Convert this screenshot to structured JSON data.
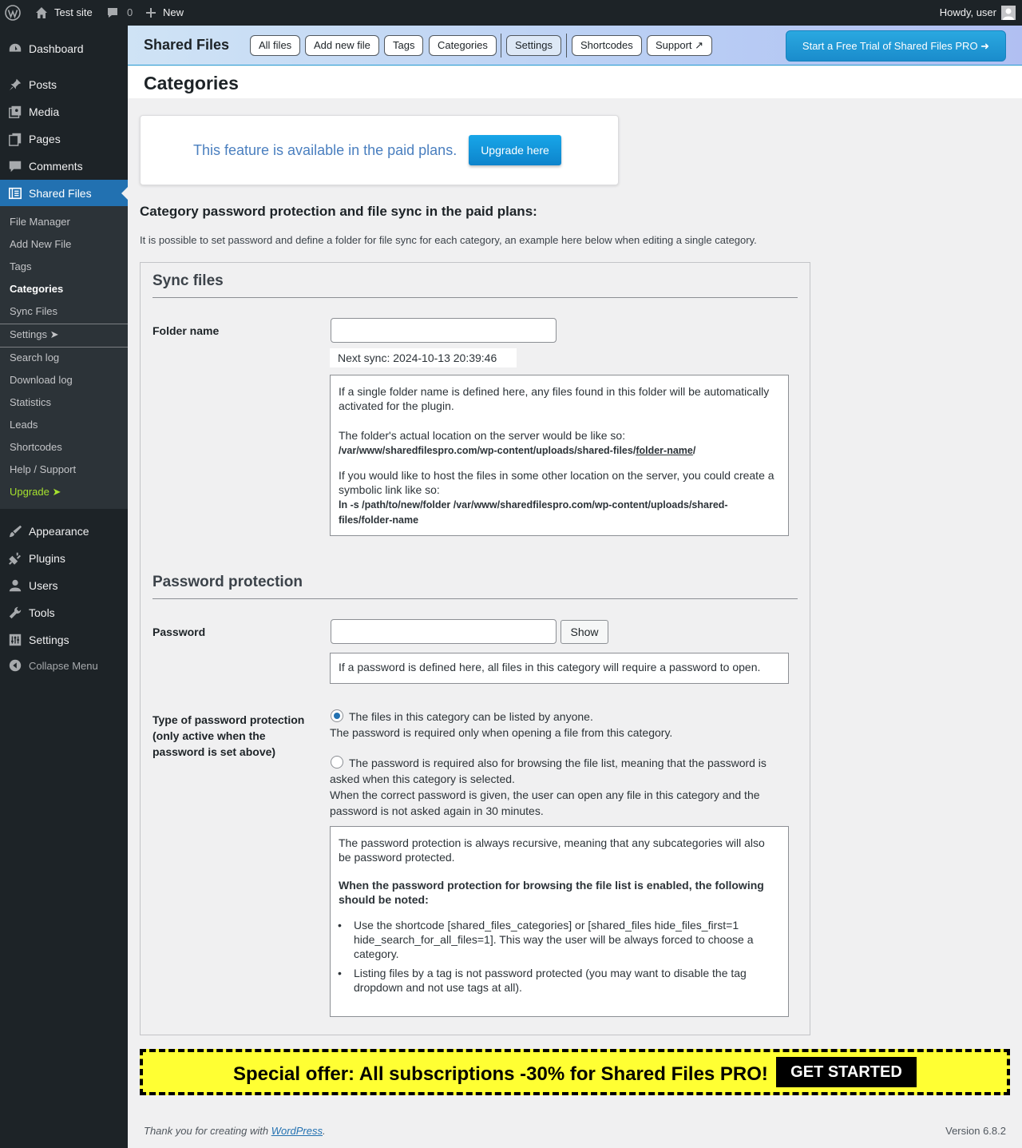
{
  "adminbar": {
    "site_name": "Test site",
    "comments_count": "0",
    "new_label": "New",
    "howdy": "Howdy, user"
  },
  "sidebar": {
    "dashboard": "Dashboard",
    "posts": "Posts",
    "media": "Media",
    "pages": "Pages",
    "comments": "Comments",
    "shared_files": "Shared Files",
    "submenu": [
      "File Manager",
      "Add New File",
      "Tags",
      "Categories",
      "Sync Files",
      "Settings ➤",
      "Search log",
      "Download log",
      "Statistics",
      "Leads",
      "Shortcodes",
      "Help / Support",
      "Upgrade ➤"
    ],
    "appearance": "Appearance",
    "plugins": "Plugins",
    "users": "Users",
    "tools": "Tools",
    "settings": "Settings",
    "collapse": "Collapse Menu"
  },
  "pluginnav": {
    "brand": "Shared Files",
    "buttons": [
      "All files",
      "Add new file",
      "Tags",
      "Categories",
      "Settings",
      "Shortcodes",
      "Support ↗"
    ],
    "trial": "Start a Free Trial of Shared Files PRO ➜"
  },
  "page": {
    "title": "Categories",
    "upgrade_text": "This feature is available in the paid plans.",
    "upgrade_button": "Upgrade here",
    "heading": "Category password protection and file sync in the paid plans:",
    "intro": "It is possible to set password and define a folder for file sync for each category, an example here below when editing a single category."
  },
  "sync": {
    "title": "Sync files",
    "folder_label": "Folder name",
    "folder_value": "",
    "next_sync": "Next sync: 2024-10-13 20:39:46",
    "info_p1": "If a single folder name is defined here, any files found in this folder will be automatically activated for the plugin.",
    "info_p2": "The folder's actual location on the server would be like so:",
    "path_prefix": "/var/www/sharedfilespro.com/wp-content/uploads/shared-files/",
    "path_folder": "folder-name",
    "path_suffix": "/",
    "info_p3": "If you would like to host the files in some other location on the server, you could create a symbolic link like so:",
    "symlink": "ln -s /path/to/new/folder /var/www/sharedfilespro.com/wp-content/uploads/shared-files/folder-name"
  },
  "password": {
    "title": "Password protection",
    "label": "Password",
    "value": "",
    "show_button": "Show",
    "info": "If a password is defined here, all files in this category will require a password to open.",
    "type_label": "Type of password protection (only active when the password is set above)",
    "option1_line1": "The files in this category can be listed by anyone.",
    "option1_line2": "The password is required only when opening a file from this category.",
    "option2_text": "The password is required also for browsing the file list, meaning that the password is asked when this category is selected.",
    "option2_extra": "When the correct password is given, the user can open any file in this category and the password is not asked again in 30 minutes.",
    "note_p1": "The password protection is always recursive, meaning that any subcategories will also be password protected.",
    "note_p2": "When the password protection for browsing the file list is enabled, the following should be noted:",
    "bullets": [
      "Use the shortcode [shared_files_categories] or [shared_files hide_files_first=1 hide_search_for_all_files=1]. This way the user will be always forced to choose a category.",
      "Listing files by a tag is not password protected (you may want to disable the tag dropdown and not use tags at all)."
    ]
  },
  "offer": {
    "text": "Special offer: All subscriptions -30% for Shared Files PRO!",
    "cta": "GET STARTED"
  },
  "footer": {
    "thanks_prefix": "Thank you for creating with ",
    "wordpress": "WordPress",
    "thanks_suffix": ".",
    "version": "Version 6.8.2"
  },
  "colors": {
    "admin_dark": "#1d2327",
    "accent": "#2271b1",
    "offer_yellow": "#ffff33",
    "upgrade_green": "#a6e22e"
  }
}
